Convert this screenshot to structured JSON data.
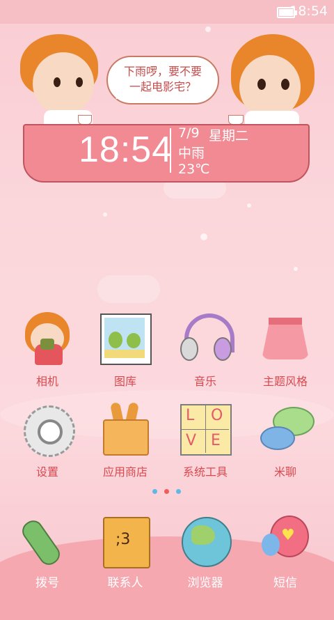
{
  "status": {
    "time": "18:54",
    "battery_level": 1.0
  },
  "widget": {
    "speech": "下雨啰，要不要\n一起电影宅？",
    "time": "18:54",
    "date": "7/9",
    "weekday": "星期二",
    "weather": "中雨",
    "temperature": "23℃"
  },
  "apps": [
    {
      "label": "相机",
      "icon": "camera-girl-icon"
    },
    {
      "label": "图库",
      "icon": "gallery-picture-icon"
    },
    {
      "label": "音乐",
      "icon": "headphones-icon"
    },
    {
      "label": "主题风格",
      "icon": "skirt-icon"
    },
    {
      "label": "设置",
      "icon": "gear-icon"
    },
    {
      "label": "应用商店",
      "icon": "shopping-bag-icon"
    },
    {
      "label": "系统工具",
      "icon": "love-tiles-icon"
    },
    {
      "label": "米聊",
      "icon": "chat-bubbles-icon"
    }
  ],
  "pages": {
    "count": 3,
    "current": 2
  },
  "dock": [
    {
      "label": "拨号",
      "icon": "phone-icon"
    },
    {
      "label": "联系人",
      "icon": "notebook-icon"
    },
    {
      "label": "浏览器",
      "icon": "globe-icon"
    },
    {
      "label": "短信",
      "icon": "heart-balloon-icon"
    }
  ],
  "colors": {
    "accent": "#d8494f",
    "table": "#f28a93",
    "background": "#fbd7dc"
  }
}
